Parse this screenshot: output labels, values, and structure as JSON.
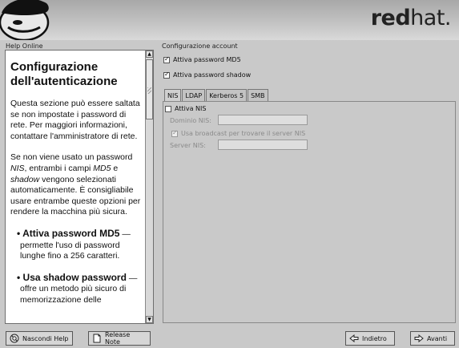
{
  "brand": {
    "bold": "red",
    "light": "hat."
  },
  "help": {
    "pane_label": "Help Online",
    "title": "Configurazione dell'autenticazione",
    "p1": "Questa sezione può essere saltata se non impostate i password di rete. Per maggiori informazioni, contattare l'amministratore di rete.",
    "p2_a": "Se non viene usato un password ",
    "p2_nis": "NIS",
    "p2_b": ", entrambi i campi ",
    "p2_md5": "MD5",
    "p2_c": " e ",
    "p2_shadow": "shadow",
    "p2_d": " vengono selezionati automaticamente. È consigliabile usare entrambe queste opzioni per rendere la macchina più sicura.",
    "b1_title": "• Attiva password MD5",
    "b1_dash": " —",
    "b1_text": "permette l'uso di password lunghe fino a 256 caratteri.",
    "b2_title": "• Usa shadow password",
    "b2_dash": " —",
    "b2_text": "offre un metodo più sicuro di memorizzazione delle"
  },
  "config": {
    "section_label": "Configurazione account",
    "md5": {
      "label": "Attiva password MD5",
      "checked": true
    },
    "shadow": {
      "label": "Attiva password shadow",
      "checked": true
    }
  },
  "tabs": [
    "NIS",
    "LDAP",
    "Kerberos 5",
    "SMB"
  ],
  "nis": {
    "enable_label": "Attiva NIS",
    "domain_label": "Dominio NIS:",
    "domain_value": "",
    "broadcast_label": "Usa broadcast per trovare il server NIS",
    "server_label": "Server NIS:",
    "server_value": ""
  },
  "buttons": {
    "hide_help": "Nascondi Help",
    "release_notes": "Release Note",
    "back": "Indietro",
    "next": "Avanti"
  }
}
